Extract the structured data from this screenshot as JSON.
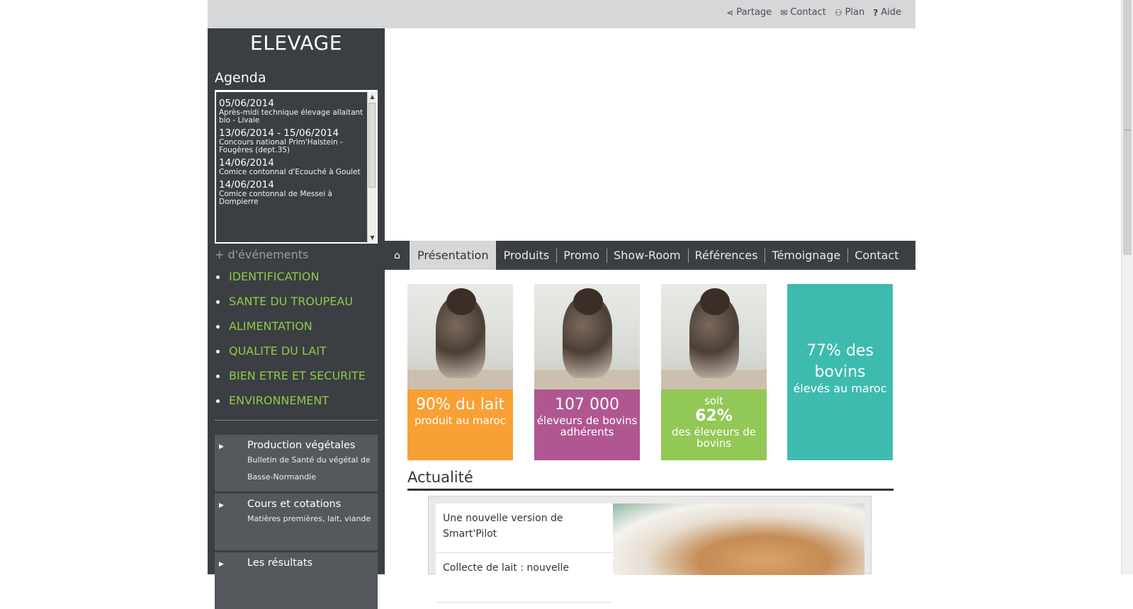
{
  "header": {
    "links": [
      {
        "icon": "share-icon",
        "glyph": "⋖",
        "label": "Partage"
      },
      {
        "icon": "mail-icon",
        "glyph": "✉",
        "label": "Contact"
      },
      {
        "icon": "sitemap-icon",
        "glyph": "⚇",
        "label": "Plan"
      },
      {
        "icon": "help-icon",
        "glyph": "?",
        "label": "Aide"
      }
    ]
  },
  "sidebar": {
    "title": "ELEVAGE",
    "agenda_title": "Agenda",
    "agenda": [
      {
        "date": "05/06/2014",
        "desc": "Après-midi technique élevage allaitant bio - Livaie"
      },
      {
        "date": "13/06/2014 - 15/06/2014",
        "desc": "Concours national Prim'Halstein - Fougères (dept.35)"
      },
      {
        "date": "14/06/2014",
        "desc": "Comice contonnal d'Ecouché à Goulet"
      },
      {
        "date": "14/06/2014",
        "desc": "Comice contonnal de Messei à Dompierre"
      }
    ],
    "more_events": "+ d'événements",
    "categories": [
      "IDENTIFICATION",
      "SANTE DU TROUPEAU",
      "ALIMENTATION",
      "QUALITE DU LAIT",
      "BIEN ETRE ET SECURITE",
      "ENVIRONNEMENT"
    ],
    "boxes": [
      {
        "title": "Production végétales",
        "subtitle": "Bulletin de Santé du végétal de Basse-Normandie"
      },
      {
        "title": "Cours et cotations",
        "subtitle": "Matières premières, lait, viande"
      },
      {
        "title": "Les résultats",
        "subtitle": ""
      }
    ]
  },
  "nav": {
    "home_icon": "home-icon",
    "items": [
      "Présentation",
      "Produits",
      "Promo",
      "Show-Room",
      "Références",
      "Témoignage",
      "Contact"
    ],
    "active": "Présentation"
  },
  "tiles": [
    {
      "big": "90% du lait",
      "small": "produit au maroc",
      "color": "#f8a034"
    },
    {
      "big": "107 000",
      "small": "éleveurs de bovins adhérents",
      "color": "#b05792"
    },
    {
      "pre": "soit",
      "big": "62%",
      "small": "des éleveurs de bovins",
      "color": "#92c856"
    },
    {
      "big": "77% des bovins",
      "small": "élevés au maroc",
      "color": "#3dbbaf"
    }
  ],
  "actualite": {
    "title": "Actualité",
    "items": [
      "Une nouvelle version de Smart'Pilot",
      "Collecte de lait : nouvelle"
    ]
  }
}
